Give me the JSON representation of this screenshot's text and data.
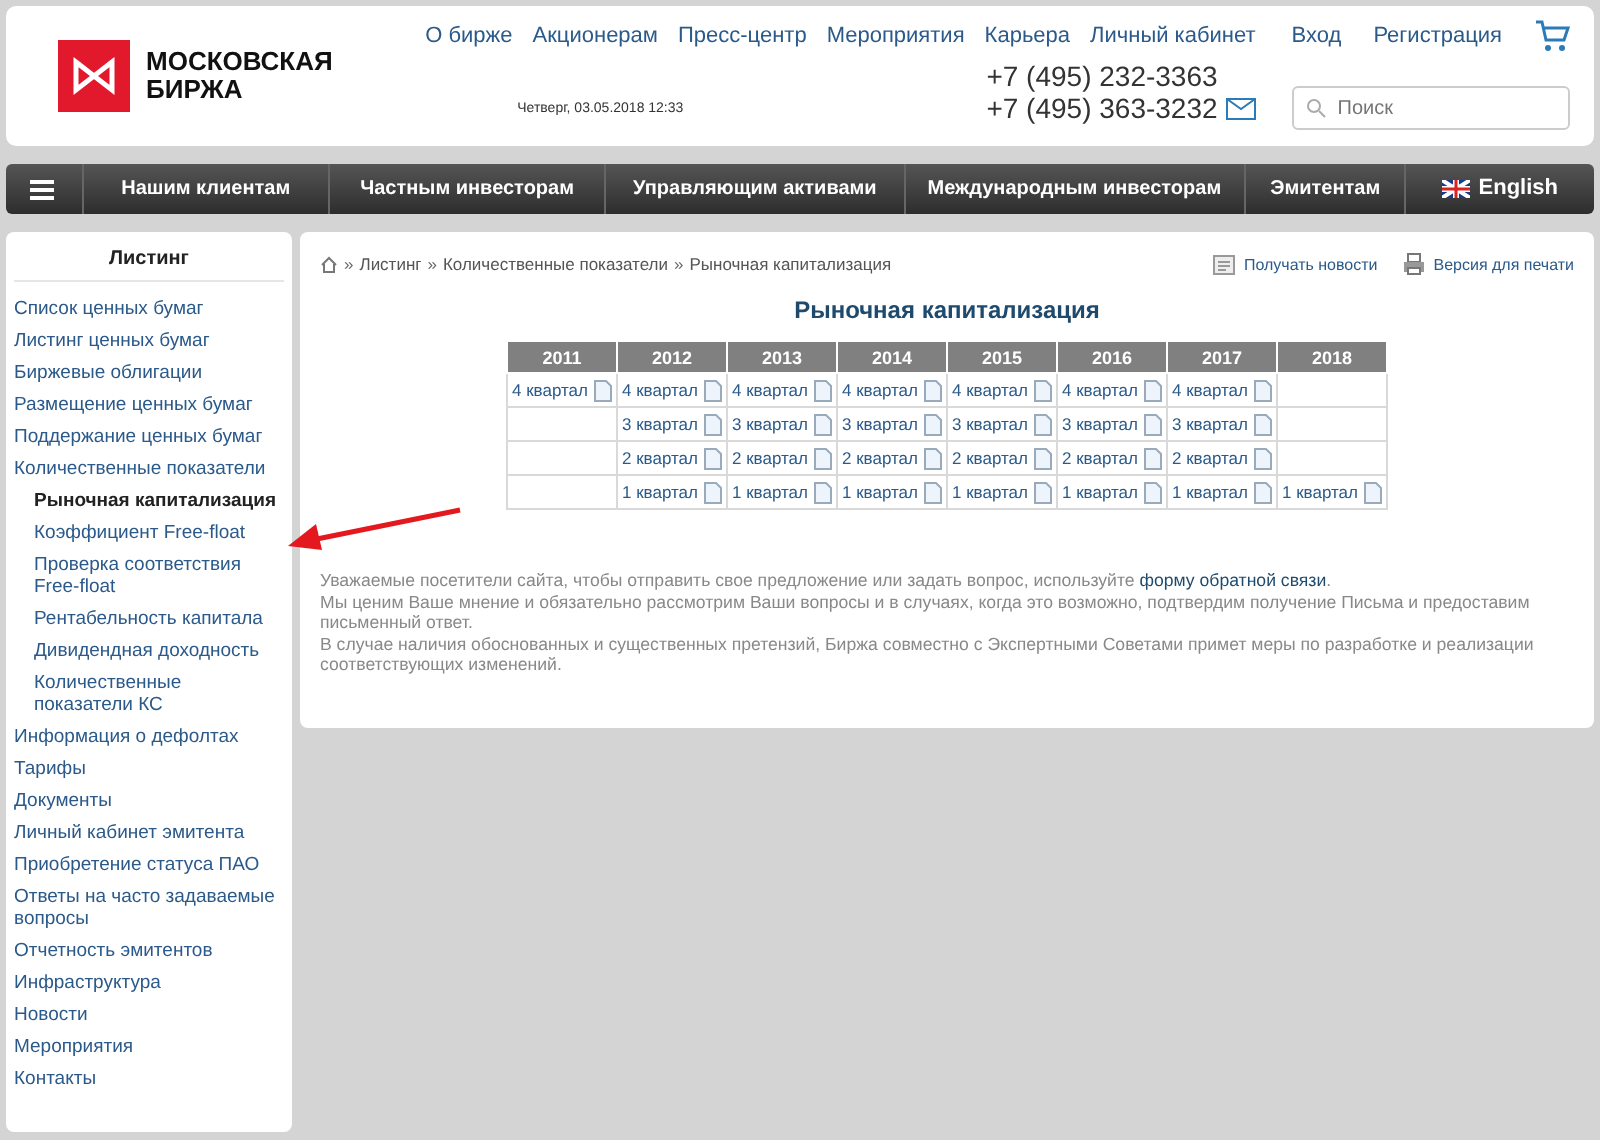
{
  "header": {
    "logo_text": [
      "МОСКОВСКАЯ",
      "БИРЖА"
    ],
    "top_links": [
      "О бирже",
      "Акционерам",
      "Пресс-центр",
      "Мероприятия",
      "Карьера",
      "Личный кабинет"
    ],
    "auth_links": [
      "Вход",
      "Регистрация"
    ],
    "datetime": "Четверг, 03.05.2018 12:33",
    "phones": [
      "+7 (495) 232-3363",
      "+7 (495) 363-3232"
    ],
    "search": {
      "placeholder": "Поиск"
    }
  },
  "nav": {
    "items": [
      "Нашим клиентам",
      "Частным инвесторам",
      "Управляющим активами",
      "Международным инвесторам",
      "Эмитентам"
    ],
    "language": "English"
  },
  "sidebar": {
    "title": "Листинг",
    "items": [
      {
        "label": "Список ценных бумаг",
        "selected": false
      },
      {
        "label": "Листинг ценных бумаг",
        "selected": false
      },
      {
        "label": "Биржевые облигации",
        "selected": false
      },
      {
        "label": "Размещение ценных бумаг",
        "selected": false
      },
      {
        "label": "Поддержание ценных бумаг",
        "selected": false
      },
      {
        "label": "Количественные показатели",
        "selected": false,
        "children": [
          {
            "label": "Рыночная капитализация",
            "selected": true
          },
          {
            "label": "Коэффициент Free-float",
            "selected": false
          },
          {
            "label": "Проверка соответствия Free-float",
            "selected": false
          },
          {
            "label": "Рентабельность капитала",
            "selected": false
          },
          {
            "label": "Дивидендная доходность",
            "selected": false
          },
          {
            "label": "Количественные показатели КС",
            "selected": false
          }
        ]
      },
      {
        "label": "Информация о дефолтах",
        "selected": false
      },
      {
        "label": "Тарифы",
        "selected": false
      },
      {
        "label": "Документы",
        "selected": false
      },
      {
        "label": "Личный кабинет эмитента",
        "selected": false
      },
      {
        "label": "Приобретение статуса ПАО",
        "selected": false
      },
      {
        "label": "Ответы на часто задаваемые вопросы",
        "selected": false
      },
      {
        "label": "Отчетность эмитентов",
        "selected": false
      },
      {
        "label": "Инфраструктура",
        "selected": false
      },
      {
        "label": "Новости",
        "selected": false
      },
      {
        "label": "Мероприятия",
        "selected": false
      },
      {
        "label": "Контакты",
        "selected": false
      }
    ]
  },
  "breadcrumb_separator": "»",
  "breadcrumbs": [
    "Листинг",
    "Количественные показатели",
    "Рыночная капитализация"
  ],
  "actions": [
    "Получать новости",
    "Версия для печати"
  ],
  "page_title": "Рыночная капитализация",
  "table": {
    "columns": [
      "2011",
      "2012",
      "2013",
      "2014",
      "2015",
      "2016",
      "2017",
      "2018"
    ],
    "rows": [
      [
        "4 квартал",
        "4 квартал",
        "4 квартал",
        "4 квартал",
        "4 квартал",
        "4 квартал",
        "4 квартал",
        null
      ],
      [
        null,
        "3 квартал",
        "3 квартал",
        "3 квартал",
        "3 квартал",
        "3 квартал",
        "3 квартал",
        null
      ],
      [
        null,
        "2 квартал",
        "2 квартал",
        "2 квартал",
        "2 квартал",
        "2 квартал",
        "2 квартал",
        null
      ],
      [
        null,
        "1 квартал",
        "1 квартал",
        "1 квартал",
        "1 квартал",
        "1 квартал",
        "1 квартал",
        "1 квартал"
      ]
    ]
  },
  "notice": {
    "intro": "Уважаемые посетители сайта, чтобы отправить свое предложение или задать вопрос, используйте",
    "link": "форму обратной связи",
    "after": ".",
    "paragraphs": [
      "Мы ценим Ваше мнение и обязательно рассмотрим Ваши вопросы и в случаях, когда это возможно, подтвердим получение Письма и предоставим письменный ответ.",
      "В случае наличия обоснованных и существенных претензий, Биржа совместно с Экспертными Советами примет меры по разработке и реализации соответствующих изменений."
    ]
  }
}
